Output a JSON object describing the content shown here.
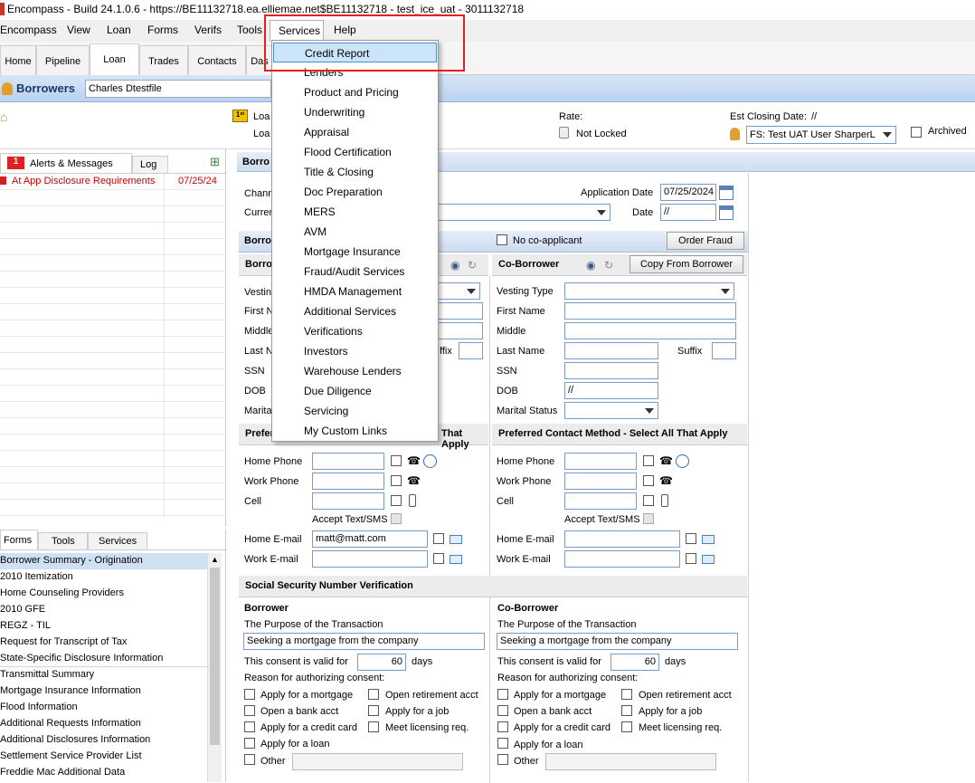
{
  "window": {
    "title": "Encompass - Build 24.1.0.6 - https://BE11132718.ea.elliemae.net$BE11132718 - test_ice_uat - 3011132718"
  },
  "menu": [
    "Encompass",
    "View",
    "Loan",
    "Forms",
    "Verifs",
    "Tools",
    "Services",
    "Help"
  ],
  "tabs": [
    "Home",
    "Pipeline",
    "Loan",
    "Trades",
    "Contacts",
    "Das"
  ],
  "borrowers_bar": {
    "label": "Borrowers",
    "selected": "Charles Dtestfile"
  },
  "header": {
    "loan_prefix": "Loa",
    "loan_prefix2": "Loa",
    "rate_label": "Rate:",
    "lock_status": "Not Locked",
    "est_closing_label": "Est Closing Date:",
    "est_closing_value": "//",
    "user_select": "FS: Test UAT User SharperL",
    "archived_label": "Archived"
  },
  "alerts": {
    "tab_alerts": "Alerts & Messages",
    "alert_count": "1",
    "tab_log": "Log",
    "rows": [
      {
        "text": "At App Disclosure Requirements",
        "date": "07/25/24"
      }
    ]
  },
  "forms_panel": {
    "tabs": [
      "Forms",
      "Tools",
      "Services"
    ],
    "items": [
      "Borrower Summary - Origination",
      "2010 Itemization",
      "Home Counseling Providers",
      "2010 GFE",
      "REGZ - TIL",
      "Request for Transcript of Tax",
      "State-Specific Disclosure Information",
      "Transmittal Summary",
      "Mortgage Insurance Information",
      "Flood Information",
      "Additional Requests Information",
      "Additional Disclosures Information",
      "Settlement Service Provider List",
      "Freddie Mac Additional Data"
    ]
  },
  "services_menu": {
    "items": [
      "Credit Report",
      "Lenders",
      "Product and Pricing",
      "Underwriting",
      "Appraisal",
      "Flood Certification",
      "Title & Closing",
      "Doc Preparation",
      "MERS",
      "AVM",
      "Mortgage Insurance",
      "Fraud/Audit Services",
      "HMDA Management",
      "Additional Services",
      "Verifications",
      "Investors",
      "Warehouse Lenders",
      "Due Diligence",
      "Servicing",
      "My Custom Links"
    ]
  },
  "form": {
    "section_title": "Borro",
    "channel_label": "Chann",
    "current_label": "Curren",
    "application_date_label": "Application Date",
    "application_date_value": "07/25/2024",
    "date_label": "Date",
    "date_value": "//",
    "borrower_pair_label": "Borro",
    "no_coapplicant_label": "No co-applicant",
    "order_fraud_button": "Order Fraud",
    "borrower_header": "Borro",
    "coborrower_header": "Co-Borrower",
    "copy_from_borrower": "Copy From Borrower",
    "borrower_labels": {
      "vesting": "Vesting",
      "first": "First N",
      "middle": "Middle",
      "last": "Last N",
      "suffix": "ffix",
      "ssn": "SSN",
      "dob": "DOB",
      "marital": "Marita"
    },
    "coborrower_labels": {
      "vesting": "Vesting Type",
      "first": "First Name",
      "middle": "Middle",
      "last": "Last Name",
      "suffix": "Suffix",
      "ssn": "SSN",
      "dob": "DOB",
      "marital": "Marital Status"
    },
    "coborrower_dob": "//",
    "contact_header_left": "Prefer",
    "contact_header_left_tail": "That Apply",
    "contact_header_right": "Preferred Contact Method - Select All That Apply",
    "contact_labels": {
      "home_phone": "Home Phone",
      "work_phone": "Work Phone",
      "cell": "Cell",
      "accept_text": "Accept Text/SMS",
      "home_email": "Home E-mail",
      "work_email": "Work E-mail"
    },
    "borrower_home_email": "matt@matt.com",
    "ssn_section_title": "Social Security Number Verification",
    "ssn_borrower": "Borrower",
    "ssn_coborrower": "Co-Borrower",
    "purpose_label": "The Purpose of the Transaction",
    "purpose_value": "Seeking a mortgage from the company",
    "consent_label": "This consent is valid for",
    "consent_days": "60",
    "days_label": "days",
    "reason_label": "Reason for authorizing consent:",
    "reasons_left": [
      "Apply for a mortgage",
      "Open a bank acct",
      "Apply for a credit card",
      "Apply for a loan",
      "Other"
    ],
    "reasons_right": [
      "Open retirement acct",
      "Apply for a job",
      "Meet licensing req."
    ]
  }
}
